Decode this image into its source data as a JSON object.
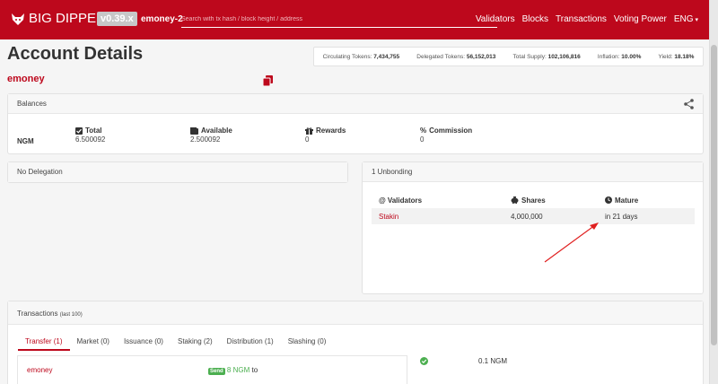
{
  "navbar": {
    "brand": "BIG DIPPER",
    "version": "v0.39.x",
    "chain_id": "emoney-2",
    "search_placeholder": "Search with tx hash / block height / address",
    "links": [
      "Validators",
      "Blocks",
      "Transactions",
      "Voting Power"
    ],
    "language": "ENG",
    "brand_color": "#bd081c"
  },
  "page": {
    "title": "Account Details",
    "account_name": "emoney"
  },
  "stats": {
    "circulating_label": "Circulating Tokens:",
    "circulating_value": "7,434,755",
    "delegated_label": "Delegated Tokens:",
    "delegated_value": "56,152,013",
    "supply_label": "Total Supply:",
    "supply_value": "102,106,816",
    "inflation_label": "Inflation:",
    "inflation_value": "10.00%",
    "yield_label": "Yield:",
    "yield_value": "18.18%"
  },
  "balances": {
    "title": "Balances",
    "denom": "NGM",
    "columns": [
      {
        "label": "Total",
        "value": "6.500092",
        "icon": "check-square-icon"
      },
      {
        "label": "Available",
        "value": "2.500092",
        "icon": "wallet-icon"
      },
      {
        "label": "Rewards",
        "value": "0",
        "icon": "gift-icon"
      },
      {
        "label": "Commission",
        "value": "0",
        "icon": "percent-icon"
      }
    ]
  },
  "delegations": {
    "title": "No Delegation"
  },
  "unbonding": {
    "title": "1 Unbonding",
    "headers": [
      "Validators",
      "Shares",
      "Mature"
    ],
    "header_prefix": "@",
    "rows": [
      {
        "validator": "Stakin",
        "shares": "4,000,000",
        "mature": "in 21 days"
      }
    ]
  },
  "transactions": {
    "title": "Transactions",
    "subtitle": "(last 100)",
    "tabs": [
      "Transfer (1)",
      "Market (0)",
      "Issuance (0)",
      "Staking (2)",
      "Distribution (1)",
      "Slashing (0)"
    ],
    "active_tab": 0,
    "rows": [
      {
        "from": "emoney",
        "badge": "Send",
        "amount": "8 NGM",
        "suffix": "to",
        "fee": "0.1 NGM"
      }
    ]
  }
}
